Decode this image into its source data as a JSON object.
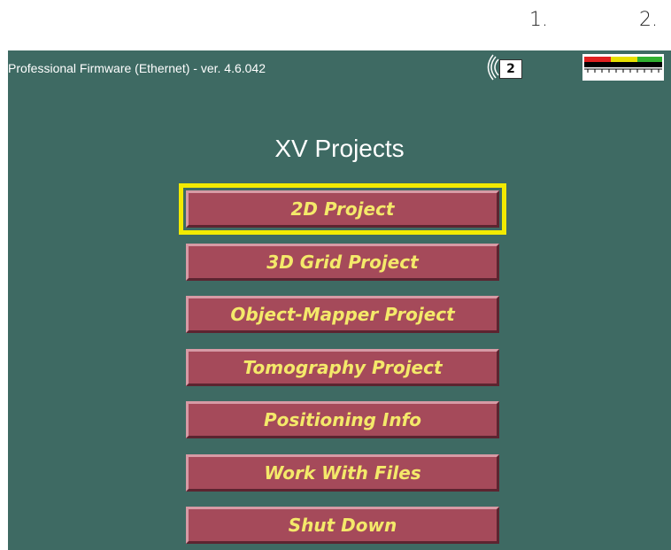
{
  "callouts": [
    "1.",
    "2."
  ],
  "header": {
    "firmware_title": "Professional Firmware (Ethernet) - ver. 4.6.042",
    "channel_badge": "2",
    "antenna_icon": "antenna-signal-icon",
    "meter_icon": "signal-level-meter-icon"
  },
  "main": {
    "title": "XV Projects",
    "focused_index": 0,
    "buttons": [
      {
        "label": "2D Project"
      },
      {
        "label": "3D Grid Project"
      },
      {
        "label": "Object-Mapper Project"
      },
      {
        "label": "Tomography Project"
      },
      {
        "label": "Positioning Info"
      },
      {
        "label": "Work With Files"
      },
      {
        "label": "Shut Down"
      }
    ]
  },
  "colors": {
    "screen_background": "#3e6a63",
    "button_fill": "#a54a5a",
    "button_text": "#f4e96a",
    "focus_outline": "#f2ea00",
    "meter_red": "#e02020",
    "meter_yellow": "#e8e000",
    "meter_green": "#30b030"
  }
}
